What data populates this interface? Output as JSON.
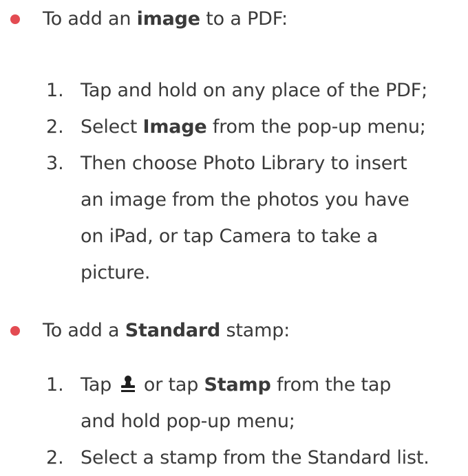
{
  "section1": {
    "bullet": {
      "pre": "To add an ",
      "bold": "image",
      "post": " to a PDF:"
    },
    "steps": [
      {
        "num": "1.",
        "lines": [
          "Tap and hold on any place of the PDF;"
        ]
      },
      {
        "num": "2.",
        "pre": "Select ",
        "bold": "Image",
        "post": " from the pop-up menu;"
      },
      {
        "num": "3.",
        "lines": [
          "Then choose Photo Library to insert",
          "an image from the photos you have",
          "on iPad, or tap Camera to take a",
          "picture."
        ]
      }
    ]
  },
  "section2": {
    "bullet": {
      "pre": "To add a ",
      "bold": "Standard",
      "post": " stamp:"
    },
    "steps": [
      {
        "num": "1.",
        "pre": "Tap ",
        "icon": "stamp-icon",
        "mid": " or tap ",
        "bold": "Stamp",
        "post": " from the tap",
        "line2": "and hold pop-up menu;"
      },
      {
        "num": "2.",
        "lines": [
          "Select a stamp from the Standard list."
        ]
      }
    ]
  },
  "colors": {
    "bullet": "#e34b52",
    "text": "#3a3a3a"
  }
}
